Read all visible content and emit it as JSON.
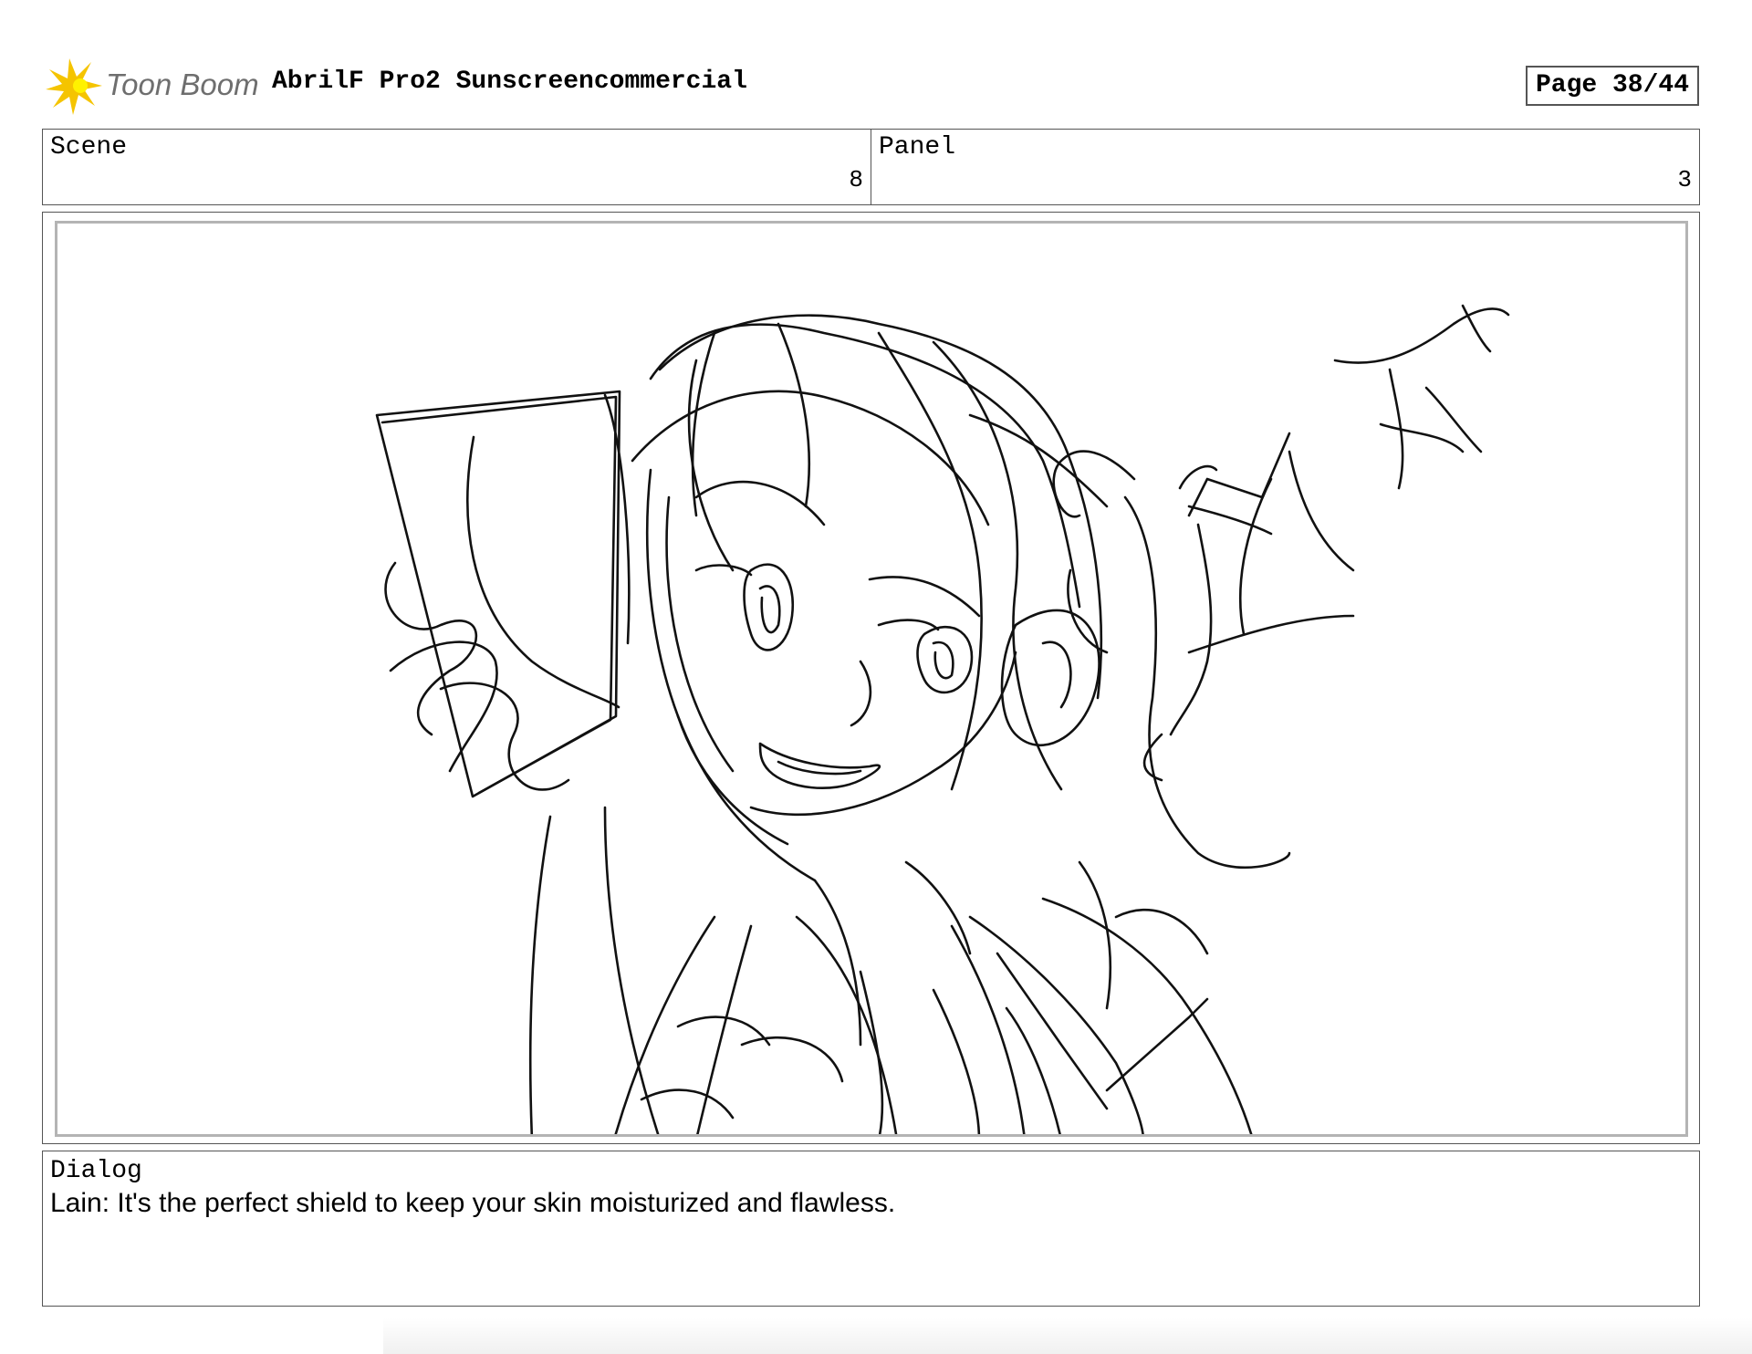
{
  "header": {
    "logo_text": "Toon Boom",
    "project_title": "AbrilF Pro2 Sunscreencommercial",
    "page_label": "Page 38/44"
  },
  "info": {
    "scene_label": "Scene",
    "scene_value": "8",
    "panel_label": "Panel",
    "panel_value": "3"
  },
  "dialog": {
    "label": "Dialog",
    "text": "Lain:  It's the perfect shield to keep your skin moisturized and flawless."
  },
  "colors": {
    "logo_yellow": "#f5c400",
    "border": "#555555",
    "frame_inner": "#b4b4b4"
  }
}
